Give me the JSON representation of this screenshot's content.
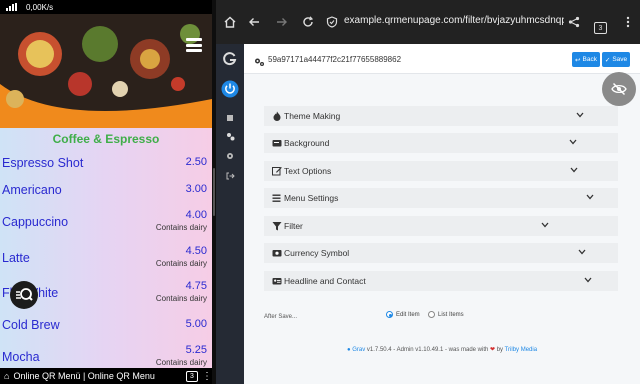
{
  "status_bar": {
    "speed": "0,00K/s"
  },
  "category_title": "Coffee & Espresso",
  "menu_items": [
    {
      "name": "Espresso Shot",
      "price": "2.50",
      "note": ""
    },
    {
      "name": "Americano",
      "price": "3.00",
      "note": ""
    },
    {
      "name": "Cappuccino",
      "price": "4.00",
      "note": "Contains dairy"
    },
    {
      "name": "Latte",
      "price": "4.50",
      "note": "Contains dairy"
    },
    {
      "name": "Flat White",
      "price": "4.75",
      "note": "Contains dairy"
    },
    {
      "name": "Cold Brew",
      "price": "5.00",
      "note": ""
    },
    {
      "name": "Mocha",
      "price": "5.25",
      "note": "Contains dairy"
    }
  ],
  "left_taskbar": {
    "tab_title": "Online QR Menü | Online QR Menu",
    "tab_count": "3"
  },
  "browser": {
    "url": "example.qrmenupage.com/filter/bvjazyuhmcsdnqpr/gen",
    "tab_count": "3"
  },
  "editor": {
    "item_id": "59a97171a44477f2c21f77655889862",
    "back_label": "Back",
    "save_label": "Save",
    "sections": [
      {
        "label": "Theme Making",
        "icon": "fire-icon"
      },
      {
        "label": "Background",
        "icon": "card-icon"
      },
      {
        "label": "Text Options",
        "icon": "edit-icon"
      },
      {
        "label": "Menu Settings",
        "icon": "list-icon"
      },
      {
        "label": "Filter",
        "icon": "filter-icon"
      },
      {
        "label": "Currency Symbol",
        "icon": "money-icon"
      },
      {
        "label": "Headline and Contact",
        "icon": "contact-card-icon"
      }
    ],
    "after_save_label": "After Save...",
    "after_save_options": [
      "Edit Item",
      "List Items"
    ],
    "after_save_selected": "Edit Item"
  },
  "footer": {
    "grav": "Grav",
    "version": " v1.7.50.4 - Admin v1.10.49.1 - was made with ",
    "heart": "❤",
    "by": " by ",
    "trilby": "Trilby Media"
  },
  "colors": {
    "accent": "#1e88e5",
    "category_green": "#3fae49",
    "menu_text": "#2a2ad0",
    "sidebar": "#252a34"
  }
}
